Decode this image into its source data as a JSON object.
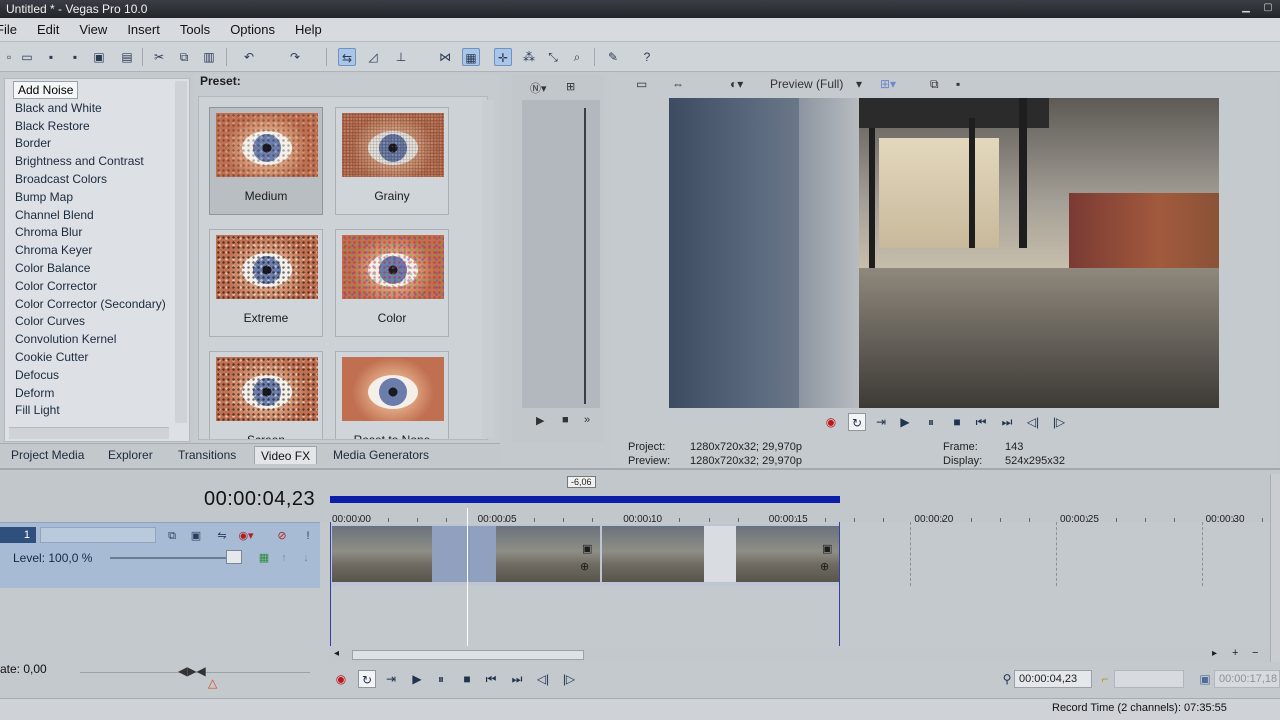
{
  "window": {
    "title": "Untitled * - Vegas Pro 10.0"
  },
  "menu": [
    "File",
    "Edit",
    "View",
    "Insert",
    "Tools",
    "Options",
    "Help"
  ],
  "fx_list": {
    "selected": "Add Noise",
    "items": [
      "Add Noise",
      "Black and White",
      "Black Restore",
      "Border",
      "Brightness and Contrast",
      "Broadcast Colors",
      "Bump Map",
      "Channel Blend",
      "Chroma Blur",
      "Chroma Keyer",
      "Color Balance",
      "Color Corrector",
      "Color Corrector (Secondary)",
      "Color Curves",
      "Convolution Kernel",
      "Cookie Cutter",
      "Defocus",
      "Deform",
      "Fill Light"
    ]
  },
  "presets": {
    "label": "Preset:",
    "items": [
      {
        "name": "Medium",
        "style": "medium"
      },
      {
        "name": "Grainy",
        "style": "grainy"
      },
      {
        "name": "Extreme",
        "style": "extreme"
      },
      {
        "name": "Color",
        "style": "color"
      },
      {
        "name": "Screen",
        "style": "screen"
      },
      {
        "name": "Reset to None",
        "style": "none"
      }
    ],
    "selected": "Medium"
  },
  "tabs": {
    "items": [
      "Project Media",
      "Explorer",
      "Transitions",
      "Video FX",
      "Media Generators"
    ],
    "active": "Video FX"
  },
  "preview": {
    "quality": "Preview (Full)",
    "project_label": "Project:",
    "project_value": "1280x720x32; 29,970p",
    "preview_label": "Preview:",
    "preview_value": "1280x720x32; 29,970p",
    "frame_label": "Frame:",
    "frame_value": "143",
    "display_label": "Display:",
    "display_value": "524x295x32"
  },
  "timeline": {
    "timecode": "00:00:04,23",
    "marker_badge": "-6,06",
    "ruler_ticks": [
      "00:00:00",
      "00:00:05",
      "00:00:10",
      "00:00:15",
      "00:00:20",
      "00:00:25",
      "00:00:30"
    ],
    "track_number": "1",
    "level": "Level: 100,0 %",
    "rate": "ate: 0,00",
    "cursor_time": "00:00:04,23",
    "end_time": "00:00:17,18"
  },
  "status": {
    "record_time": "Record Time (2 channels): 07:35:55"
  }
}
